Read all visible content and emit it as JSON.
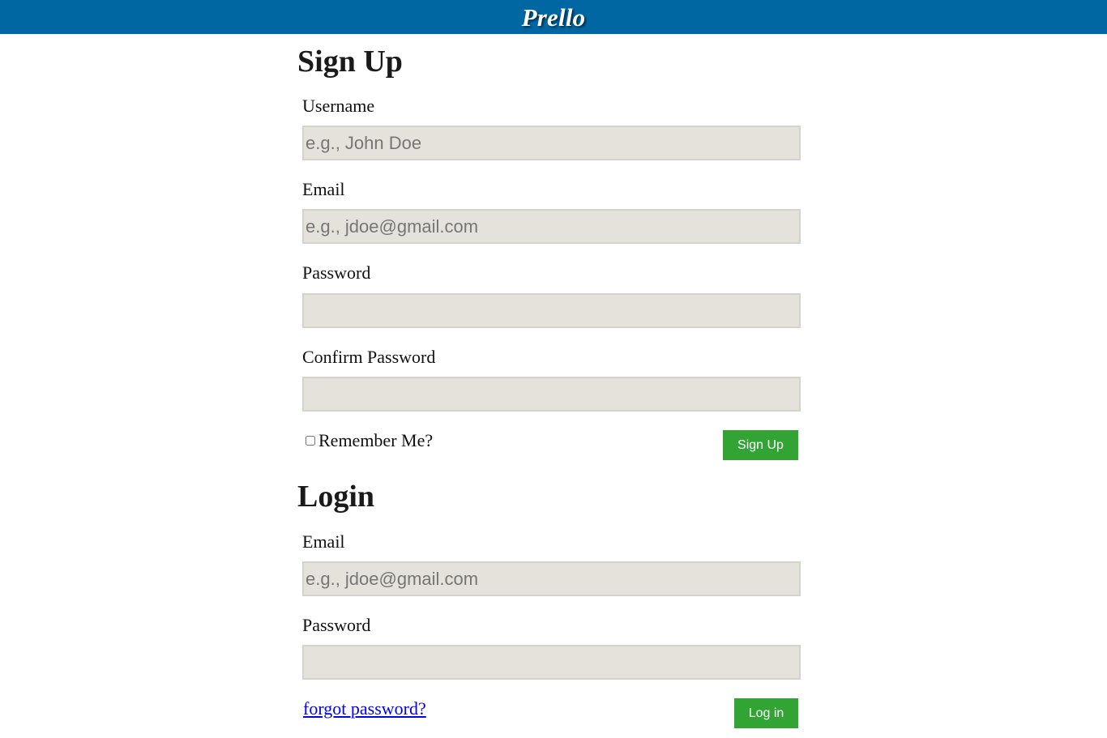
{
  "app": {
    "brand": "Prello",
    "brand_color": "#0067a3",
    "button_color": "#32a434",
    "input_bg": "#e5e2dc"
  },
  "signup": {
    "title": "Sign Up",
    "username_label": "Username",
    "username_placeholder": "e.g., John Doe",
    "email_label": "Email",
    "email_placeholder": "e.g., jdoe@gmail.com",
    "password_label": "Password",
    "confirm_label": "Confirm Password",
    "remember_label": "Remember Me?",
    "remember_checked": false,
    "submit_label": "Sign Up"
  },
  "login": {
    "title": "Login",
    "email_label": "Email",
    "email_placeholder": "e.g., jdoe@gmail.com",
    "password_label": "Password",
    "forgot_link": "forgot password?",
    "submit_label": "Log in"
  }
}
